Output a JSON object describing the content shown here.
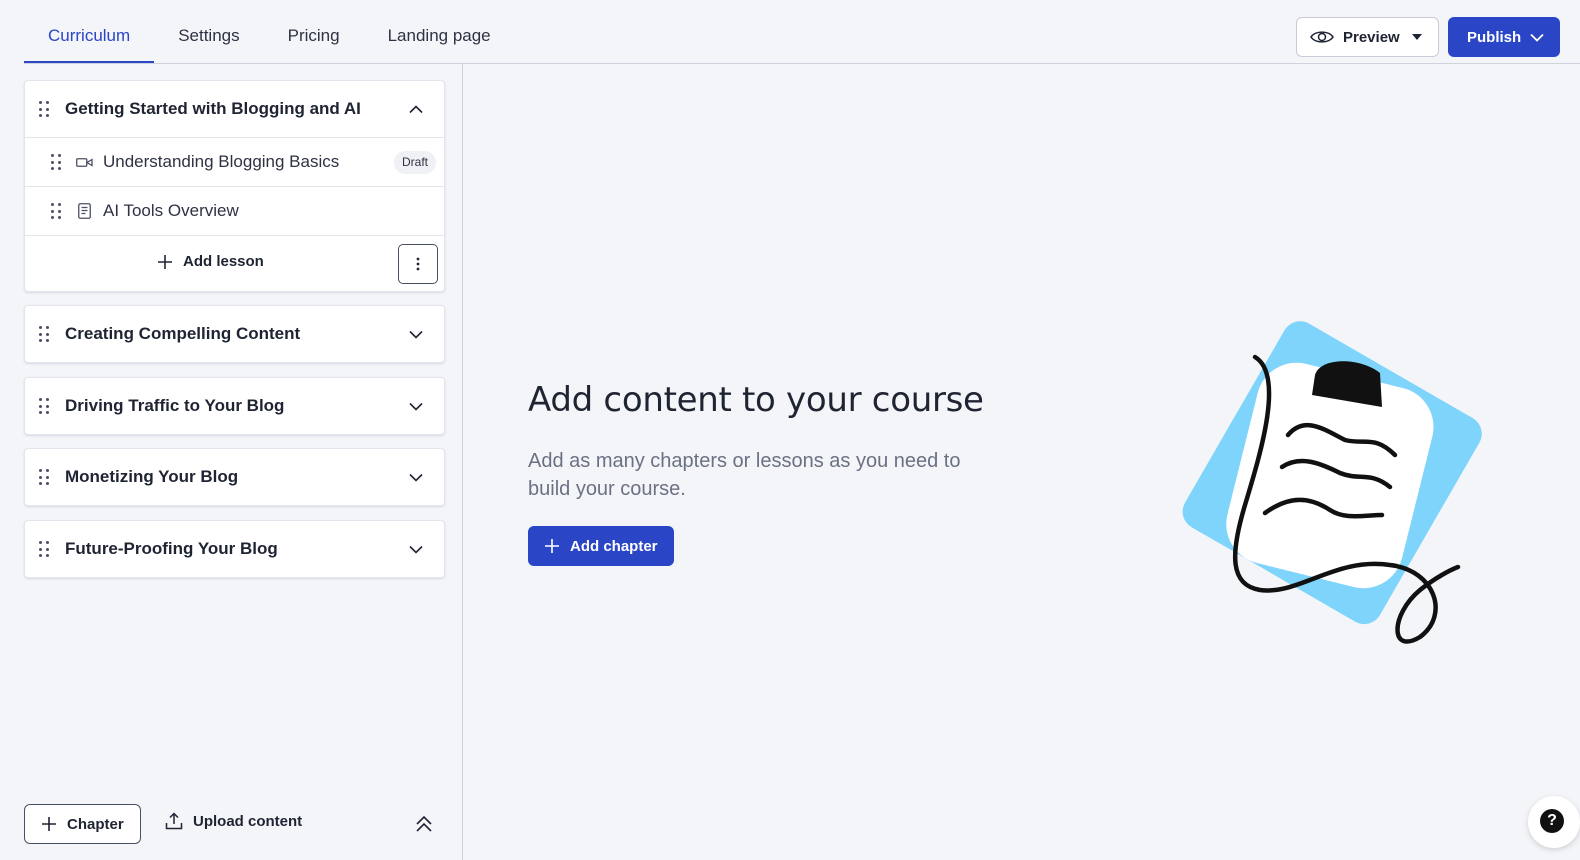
{
  "tabs": [
    {
      "label": "Curriculum",
      "active": true
    },
    {
      "label": "Settings",
      "active": false
    },
    {
      "label": "Pricing",
      "active": false
    },
    {
      "label": "Landing page",
      "active": false
    }
  ],
  "header": {
    "preview_label": "Preview",
    "publish_label": "Publish"
  },
  "chapters": [
    {
      "title": "Getting Started with Blogging and AI",
      "expanded": true,
      "lessons": [
        {
          "title": "Understanding Blogging Basics",
          "type": "video-icon",
          "badge": "Draft"
        },
        {
          "title": "AI Tools Overview",
          "type": "document-icon"
        }
      ],
      "add_lesson_label": "Add lesson"
    },
    {
      "title": "Creating Compelling Content",
      "expanded": false
    },
    {
      "title": "Driving Traffic to Your Blog",
      "expanded": false
    },
    {
      "title": "Monetizing Your Blog",
      "expanded": false
    },
    {
      "title": "Future-Proofing Your Blog",
      "expanded": false
    }
  ],
  "sidebar_footer": {
    "chapter_label": "Chapter",
    "upload_label": "Upload content"
  },
  "empty_state": {
    "title": "Add content to your course",
    "description": "Add as many chapters or lessons as you need to build your course.",
    "button_label": "Add chapter"
  },
  "help": {
    "label": "?"
  },
  "colors": {
    "accent": "#2a45c6",
    "illustration_blue": "#7fd4fb"
  }
}
